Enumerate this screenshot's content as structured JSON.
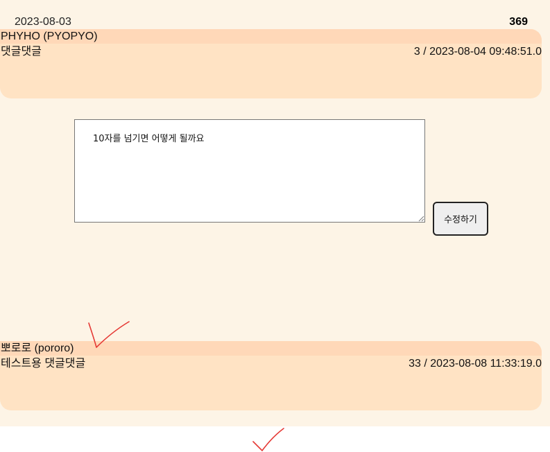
{
  "post": {
    "date": "2023-08-03",
    "count": "369"
  },
  "comments": [
    {
      "author": "PHYHO (PYOPYO)",
      "body": "댓글댓글",
      "meta": "3 / 2023-08-04 09:48:51.0"
    },
    {
      "author": "뽀로로 (pororo)",
      "body": "테스트용 댓글댓글",
      "meta": "33 / 2023-08-08 11:33:19.0"
    }
  ],
  "edit_form": {
    "textarea_value": "10자를 넘기면 어떻게 될까요",
    "submit_label": "수정하기"
  },
  "colors": {
    "panel_background": "#fdf4e6",
    "comment_background": "#ffe3c4",
    "comment_header": "#ffd8b8",
    "checkmark": "#e53935"
  },
  "annotations": [
    {
      "icon": "checkmark-icon"
    },
    {
      "icon": "checkmark-icon"
    }
  ]
}
